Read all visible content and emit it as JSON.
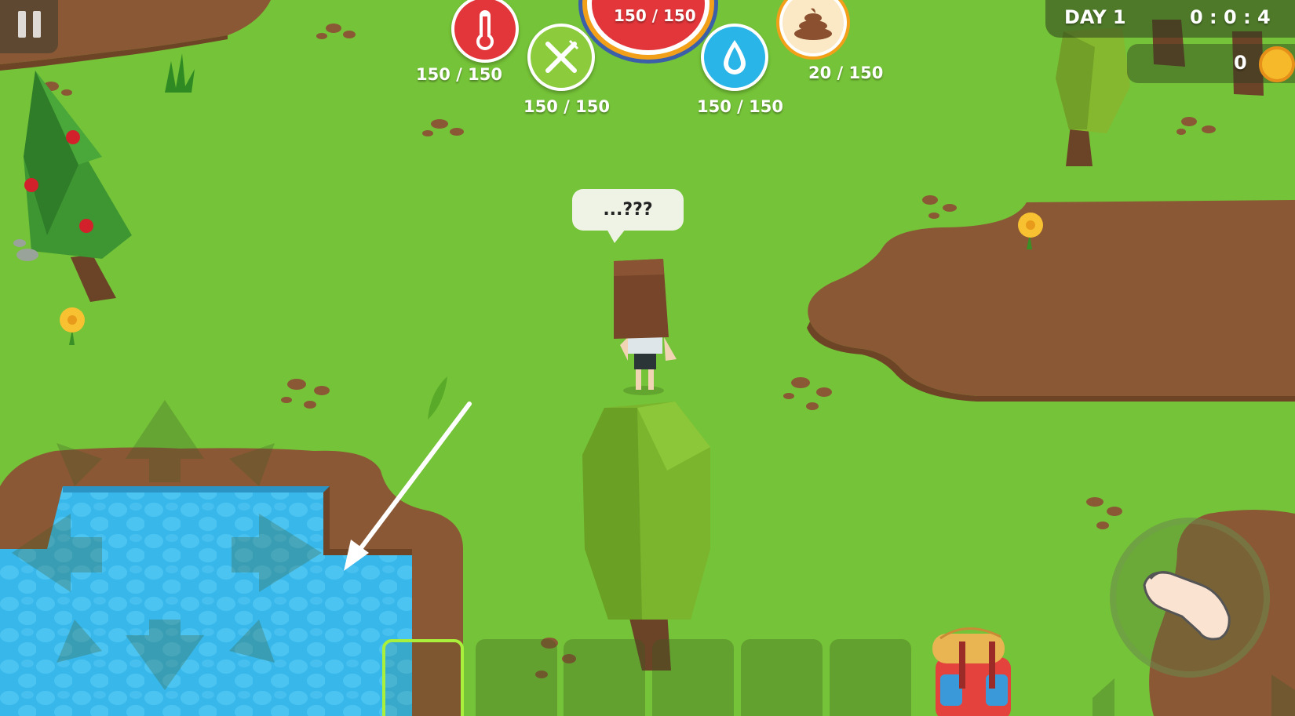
{
  "hud": {
    "health": {
      "icon": "thermometer-icon",
      "value": "150 / 150",
      "color": "#e2363a"
    },
    "hunger": {
      "icon": "fork-knife-icon",
      "value": "150 / 150",
      "color": "#8ccc3c"
    },
    "center_gauge": {
      "value": "150 / 150",
      "color": "#e2363a"
    },
    "thirst": {
      "icon": "water-drop-icon",
      "value": "150 / 150",
      "color": "#29b5e8"
    },
    "poop": {
      "icon": "poop-icon",
      "value": "20 / 150",
      "color": "#f2a01a"
    },
    "day_label": "DAY 1",
    "time": "0 : 0 : 4",
    "coins": "0"
  },
  "speech_bubble": "...???",
  "controls": {
    "pause": "pause-icon",
    "dpad": "dpad",
    "action": "hand-icon",
    "backpack": "backpack-icon"
  },
  "hotbar": {
    "slots": 6,
    "selected_index": 0
  }
}
